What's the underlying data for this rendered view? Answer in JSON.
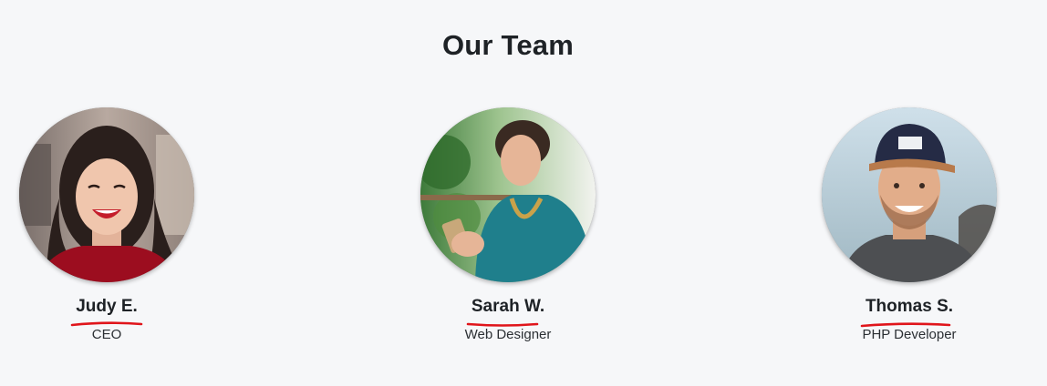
{
  "section": {
    "title": "Our Team"
  },
  "members": [
    {
      "name": "Judy E.",
      "role": "CEO",
      "photo": "woman-laughing-red-top-photo"
    },
    {
      "name": "Sarah W.",
      "role": "Web Designer",
      "photo": "woman-with-phone-teal-shirt-photo"
    },
    {
      "name": "Thomas S.",
      "role": "PHP Developer",
      "photo": "man-with-cap-smiling-photo"
    }
  ],
  "colors": {
    "background": "#f6f7f9",
    "heading": "#1e2226",
    "underline_accent": "#e0151b"
  }
}
